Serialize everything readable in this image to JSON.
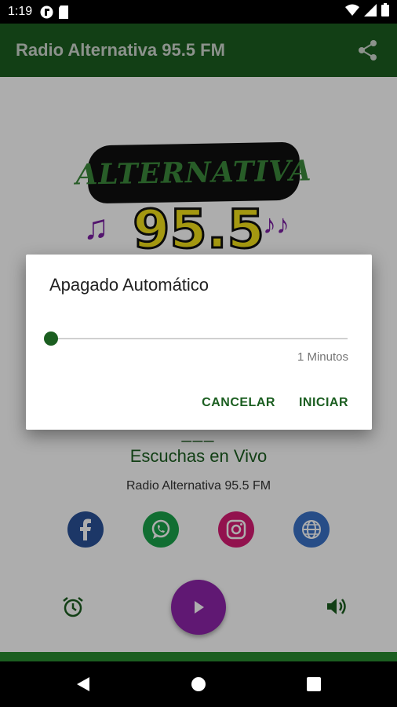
{
  "status_bar": {
    "time": "1:19",
    "icons": [
      "notification-icon",
      "sd-card-icon",
      "wifi-icon",
      "signal-icon",
      "battery-icon"
    ]
  },
  "app_bar": {
    "title": "Radio Alternativa 95.5 FM",
    "share_icon": "share-icon"
  },
  "logo": {
    "title": "ALTERNATIVA",
    "number": "95.5",
    "note_left": "♫",
    "note_right": "♪♪"
  },
  "player": {
    "listener_count": "___",
    "listeners_label": "Escuchas en Vivo",
    "station_name": "Radio Alternativa 95.5 FM",
    "social": [
      "facebook-icon",
      "whatsapp-icon",
      "instagram-icon",
      "globe-icon"
    ],
    "controls": [
      "alarm-icon",
      "play-icon",
      "volume-icon"
    ]
  },
  "dialog": {
    "title": "Apagado Automático",
    "slider_value_label": "1 Minutos",
    "slider_fraction": 0,
    "cancel_label": "CANCELAR",
    "start_label": "INICIAR"
  },
  "nav_bar": {
    "icons": [
      "back-icon",
      "home-icon",
      "recents-icon"
    ]
  },
  "colors": {
    "primary": "#1b5e20",
    "accent": "#8e24aa",
    "status_bar": "#000000"
  }
}
